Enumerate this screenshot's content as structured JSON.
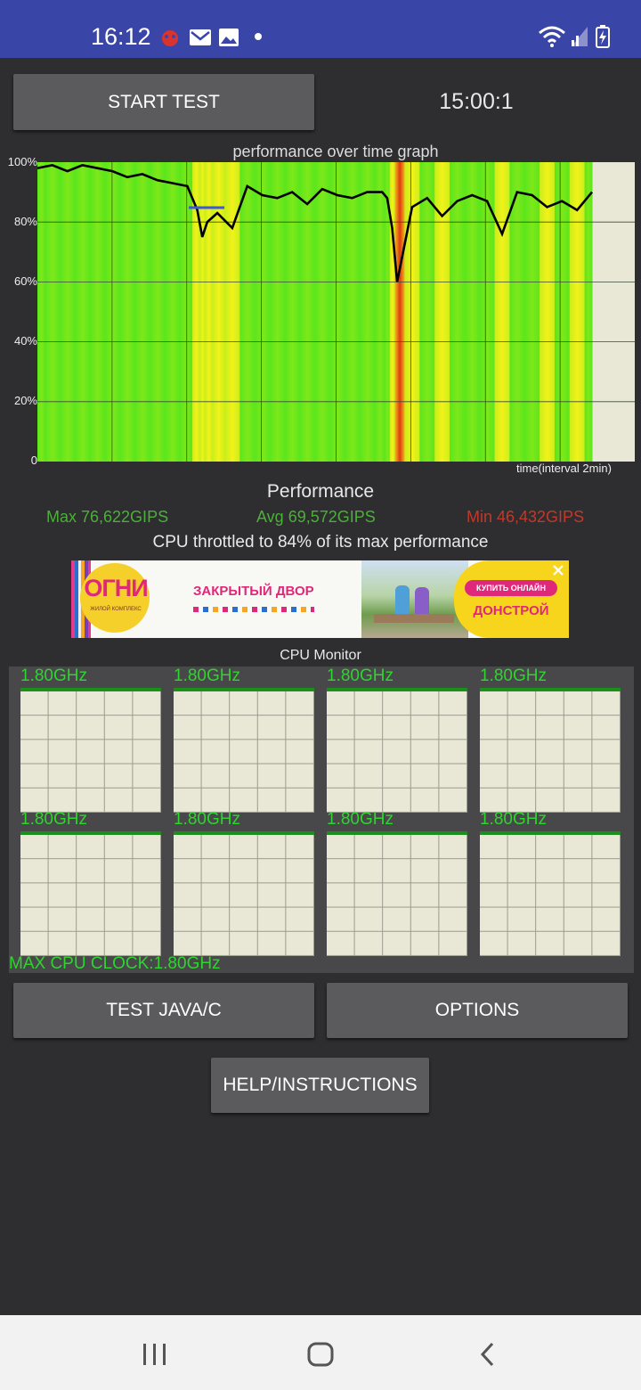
{
  "status_bar": {
    "time": "16:12",
    "left_icons": [
      "notification-bug-icon",
      "gmail-icon",
      "gallery-icon",
      "dot-icon"
    ],
    "right_icons": [
      "wifi-icon",
      "signal-icon",
      "battery-charging-icon"
    ]
  },
  "controls": {
    "start_label": "START TEST",
    "timer": "15:00:1"
  },
  "graph": {
    "title": "performance over time graph",
    "x_label": "time(interval 2min)",
    "y_ticks": [
      "100%",
      "80%",
      "60%",
      "40%",
      "20%",
      "0"
    ]
  },
  "chart_data": {
    "type": "line",
    "title": "performance over time graph",
    "xlabel": "time(interval 2min)",
    "ylabel": "",
    "ylim": [
      0,
      100
    ],
    "grid": true,
    "x": [
      0,
      3,
      6,
      9,
      12,
      15,
      18,
      21,
      24,
      27,
      30,
      32,
      33,
      34,
      36,
      39,
      42,
      45,
      48,
      51,
      54,
      57,
      60,
      63,
      66,
      69,
      70,
      71,
      72,
      75,
      78,
      81,
      84,
      87,
      90,
      93,
      96,
      99,
      102,
      105,
      108,
      111
    ],
    "series": [
      {
        "name": "",
        "values": [
          98,
          99,
          97,
          99,
          98,
          97,
          95,
          96,
          94,
          93,
          92,
          84,
          75,
          80,
          83,
          78,
          92,
          89,
          88,
          90,
          86,
          91,
          89,
          88,
          90,
          90,
          88,
          78,
          60,
          85,
          88,
          82,
          87,
          89,
          87,
          76,
          90,
          89,
          85,
          87,
          84,
          90
        ]
      }
    ]
  },
  "performance": {
    "title": "Performance",
    "max": "Max 76,622GIPS",
    "avg": "Avg 69,572GIPS",
    "min": "Min 46,432GIPS",
    "throttle": "CPU throttled to 84% of its max performance",
    "colors": {
      "max": "#4caf3a",
      "avg": "#4caf3a",
      "min": "#c0392b"
    }
  },
  "ad": {
    "brand": "ОГНИ",
    "brand_sub": "ЖИЛОЙ КОМПЛЕКС",
    "headline": "ЗАКРЫТЫЙ ДВОР",
    "cta": "КУПИТЬ ОНЛАЙН",
    "developer": "ДОНСТРОЙ",
    "close_icon": "close-icon"
  },
  "cpu_monitor": {
    "title": "CPU Monitor",
    "cores": [
      {
        "freq": "1.80GHz"
      },
      {
        "freq": "1.80GHz"
      },
      {
        "freq": "1.80GHz"
      },
      {
        "freq": "1.80GHz"
      },
      {
        "freq": "1.80GHz"
      },
      {
        "freq": "1.80GHz"
      },
      {
        "freq": "1.80GHz"
      },
      {
        "freq": "1.80GHz"
      }
    ],
    "max_clock": "MAX CPU CLOCK:1.80GHz"
  },
  "buttons": {
    "test_java": "TEST JAVA/C",
    "options": "OPTIONS",
    "help": "HELP/INSTRUCTIONS"
  },
  "nav": [
    "recents-icon",
    "home-icon",
    "back-icon"
  ]
}
